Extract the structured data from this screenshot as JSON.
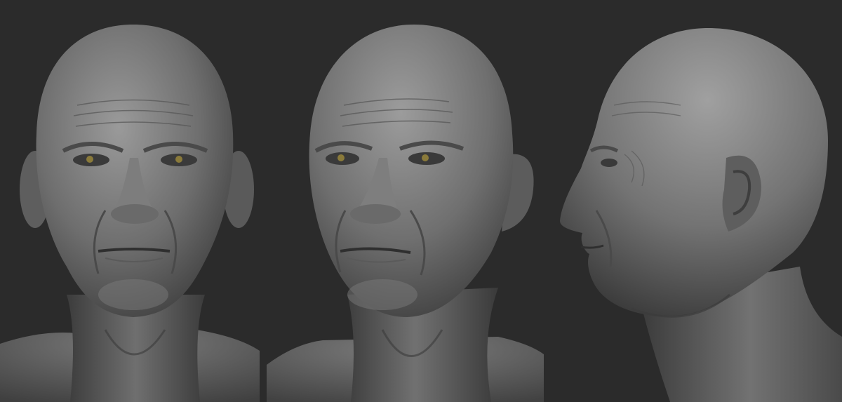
{
  "scene": {
    "background": "#2b2b2b",
    "material_color": "#8f8f8f",
    "eye_color": "#8a7a3a",
    "views": [
      {
        "id": "front",
        "icon": "front-view-head-icon"
      },
      {
        "id": "three-quarter",
        "icon": "three-quarter-view-head-icon"
      },
      {
        "id": "profile",
        "icon": "profile-view-head-icon"
      }
    ]
  }
}
